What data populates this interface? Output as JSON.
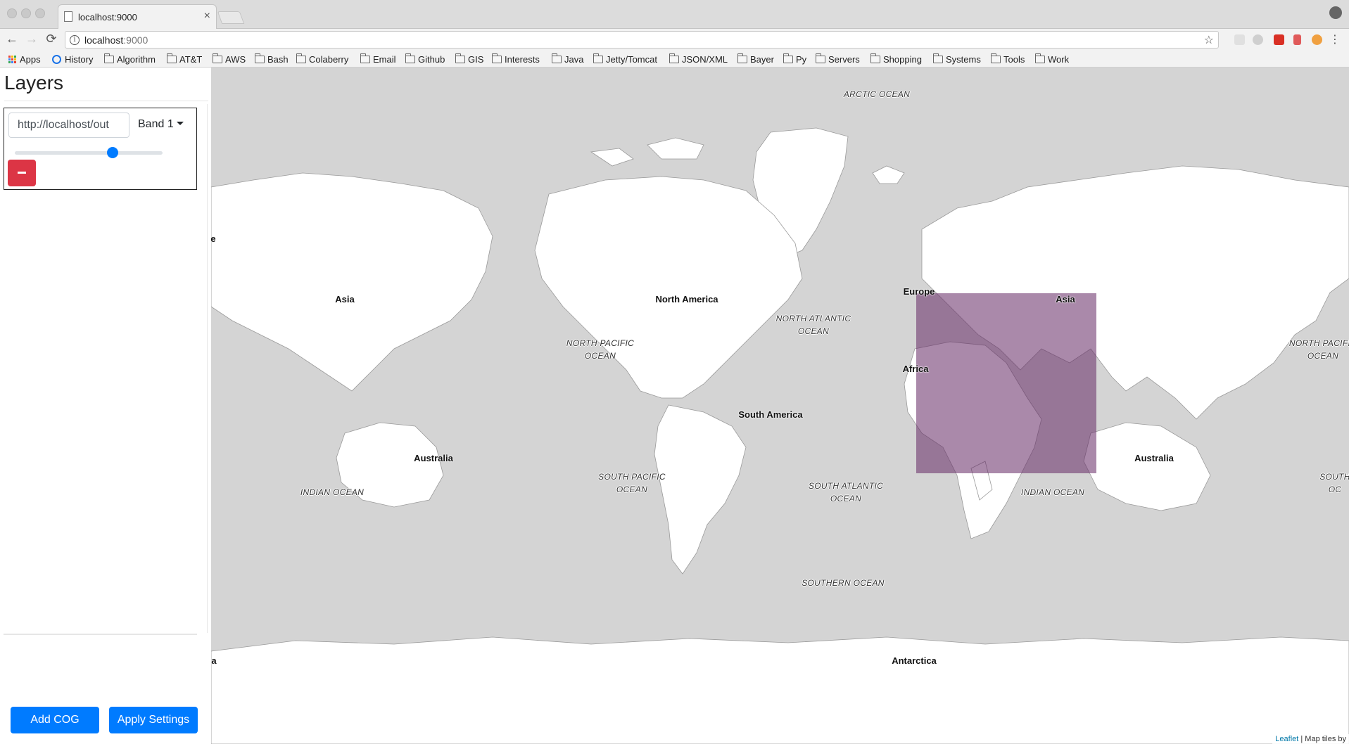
{
  "browser": {
    "tab_title": "localhost:9000",
    "tab_close": "×",
    "url_host": "localhost",
    "url_port": ":9000",
    "info_glyph": "i",
    "star_glyph": "☆",
    "back_glyph": "←",
    "forward_glyph": "→",
    "reload_glyph": "⟳",
    "menu_glyph": "⋮",
    "bookmarks": [
      {
        "label": "Apps",
        "icon": "apps-icon"
      },
      {
        "label": "History",
        "icon": "history-icon"
      },
      {
        "label": "Algorithm",
        "icon": "folder-icon"
      },
      {
        "label": "AT&T",
        "icon": "folder-icon"
      },
      {
        "label": "AWS",
        "icon": "folder-icon"
      },
      {
        "label": "Bash",
        "icon": "folder-icon"
      },
      {
        "label": "Colaberry",
        "icon": "folder-icon"
      },
      {
        "label": "Email",
        "icon": "folder-icon"
      },
      {
        "label": "Github",
        "icon": "folder-icon"
      },
      {
        "label": "GIS",
        "icon": "folder-icon"
      },
      {
        "label": "Interests",
        "icon": "folder-icon"
      },
      {
        "label": "Java",
        "icon": "folder-icon"
      },
      {
        "label": "Jetty/Tomcat",
        "icon": "folder-icon"
      },
      {
        "label": "JSON/XML",
        "icon": "folder-icon"
      },
      {
        "label": "Bayer",
        "icon": "folder-icon"
      },
      {
        "label": "Py",
        "icon": "folder-icon"
      },
      {
        "label": "Servers",
        "icon": "folder-icon"
      },
      {
        "label": "Shopping",
        "icon": "folder-icon"
      },
      {
        "label": "Systems",
        "icon": "folder-icon"
      },
      {
        "label": "Tools",
        "icon": "folder-icon"
      },
      {
        "label": "Work",
        "icon": "folder-icon"
      }
    ]
  },
  "sidebar": {
    "title": "Layers",
    "layers": [
      {
        "url_value": "http://localhost/out",
        "band_label": "Band 1",
        "opacity": 0.66
      }
    ],
    "add_button": "Add COG",
    "apply_button": "Apply Settings"
  },
  "map": {
    "land_color": "#ffffff",
    "water_color": "#d4d4d4",
    "overlay_color": "#642864",
    "continents": {
      "asia_left": "Asia",
      "north_america": "North America",
      "europe": "Europe",
      "africa": "Africa",
      "asia_right": "Asia",
      "south_america": "South America",
      "australia_left": "Australia",
      "australia_right": "Australia",
      "antarctica": "Antarctica",
      "europe_partial": "e",
      "antarctica_partial": "a"
    },
    "oceans": {
      "arctic": "ARCTIC OCEAN",
      "north_pacific_left": "NORTH PACIFIC OCEAN",
      "north_atlantic": "NORTH ATLANTIC OCEAN",
      "north_pacific_right": "NORTH PACIFIC OCEAN",
      "south_pacific": "SOUTH PACIFIC OCEAN",
      "south_atlantic": "SOUTH ATLANTIC OCEAN",
      "indian_left": "INDIAN OCEAN",
      "indian_right": "INDIAN OCEAN",
      "south_partial": "SOUTH OC",
      "southern": "SOUTHERN OCEAN"
    },
    "attribution_link": "Leaflet",
    "attribution_text": " | Map tiles by"
  }
}
